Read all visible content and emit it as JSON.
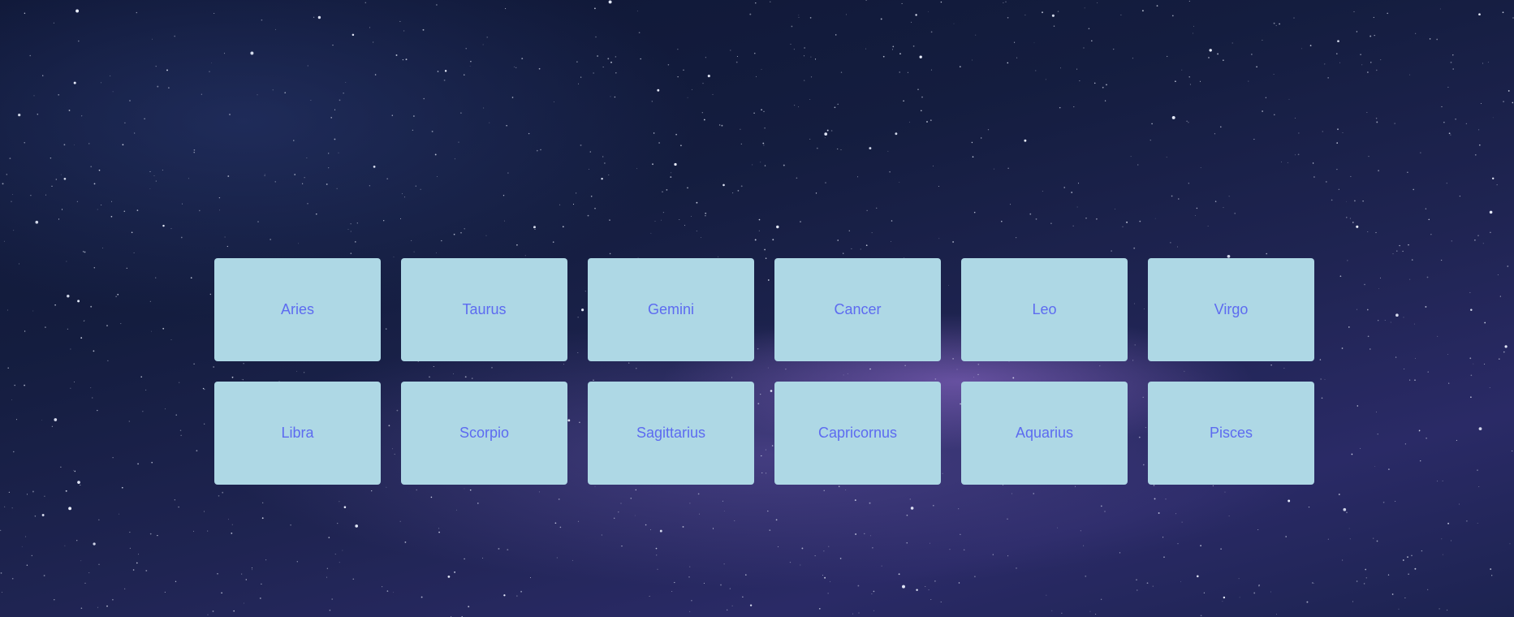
{
  "colors": {
    "card_background": "#aed8e5",
    "card_text": "#5d6bf0",
    "sky_dark": "#0e1634",
    "nebula": "#966ed2"
  },
  "signs": [
    {
      "label": "Aries"
    },
    {
      "label": "Taurus"
    },
    {
      "label": "Gemini"
    },
    {
      "label": "Cancer"
    },
    {
      "label": "Leo"
    },
    {
      "label": "Virgo"
    },
    {
      "label": "Libra"
    },
    {
      "label": "Scorpio"
    },
    {
      "label": "Sagittarius"
    },
    {
      "label": "Capricornus"
    },
    {
      "label": "Aquarius"
    },
    {
      "label": "Pisces"
    }
  ]
}
